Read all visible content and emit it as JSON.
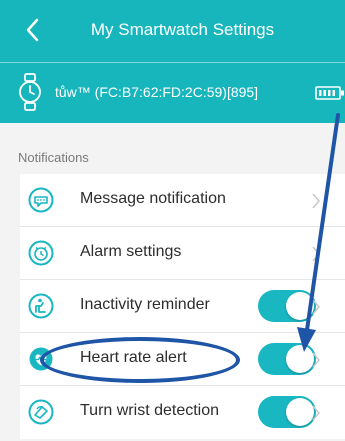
{
  "header": {
    "title": "My Smartwatch Settings",
    "device_name": "tůw™ (FC:B7:62:FD:2C:59)[895]"
  },
  "notifications": {
    "section_title": "Notifications",
    "items": [
      {
        "label": "Message notification",
        "control": "chevron"
      },
      {
        "label": "Alarm settings",
        "control": "chevron"
      },
      {
        "label": "Inactivity reminder",
        "control": "toggle",
        "on": true
      },
      {
        "label": "Heart rate alert",
        "control": "toggle",
        "on": true
      },
      {
        "label": "Turn wrist detection",
        "control": "toggle",
        "on": true
      }
    ]
  },
  "icons": {
    "back": "back-arrow-icon",
    "watch": "smartwatch-icon",
    "battery": "battery-icon",
    "message": "message-icon",
    "alarm": "alarm-icon",
    "inactivity": "inactivity-icon",
    "heart": "heart-rate-icon",
    "wrist": "turn-wrist-icon"
  },
  "colors": {
    "header": "#17b6bd",
    "accent": "#19b7c2",
    "annotation": "#1f55a7"
  }
}
